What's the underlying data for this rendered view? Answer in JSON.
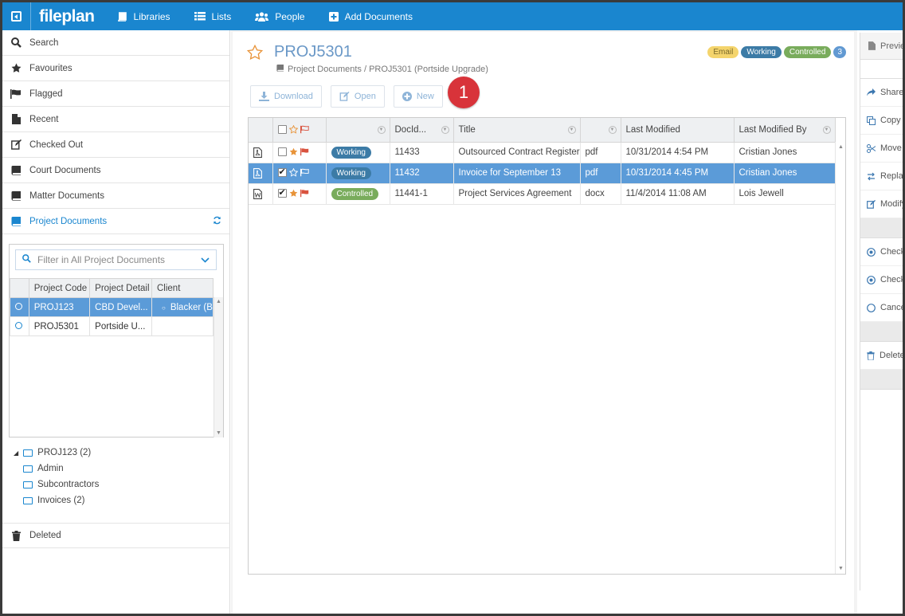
{
  "app": {
    "logo": "fileplan"
  },
  "nav": [
    {
      "label": "Libraries",
      "icon": "book-icon"
    },
    {
      "label": "Lists",
      "icon": "list-icon"
    },
    {
      "label": "People",
      "icon": "people-icon"
    },
    {
      "label": "Add Documents",
      "icon": "plus-box-icon"
    }
  ],
  "sidebar": {
    "items": [
      {
        "label": "Search"
      },
      {
        "label": "Favourites"
      },
      {
        "label": "Flagged"
      },
      {
        "label": "Recent"
      },
      {
        "label": "Checked Out"
      },
      {
        "label": "Court Documents"
      },
      {
        "label": "Matter Documents"
      },
      {
        "label": "Project Documents"
      }
    ],
    "filter_placeholder": "Filter in All Project Documents",
    "table": {
      "headers": [
        "Project Code",
        "Project Detail",
        "Client"
      ],
      "rows": [
        {
          "code": "PROJ123",
          "detail": "CBD Devel...",
          "client": "Blacker (B"
        },
        {
          "code": "PROJ5301",
          "detail": "Portside U...",
          "client": ""
        }
      ]
    },
    "tree": {
      "root": "PROJ123 (2)",
      "children": [
        "Admin",
        "Subcontractors",
        "Invoices (2)"
      ]
    },
    "deleted_label": "Deleted"
  },
  "main": {
    "title": "PROJ5301",
    "breadcrumb": "Project Documents / PROJ5301 (Portside Upgrade)",
    "badges": {
      "email": "Email",
      "working": "Working",
      "controlled": "Controlled",
      "count": "3"
    },
    "toolbar": {
      "download": "Download",
      "open": "Open",
      "new": "New"
    },
    "step_marker": "1",
    "grid": {
      "headers": {
        "docid": "DocId...",
        "title": "Title",
        "last_modified": "Last Modified",
        "last_modified_by": "Last Modified By"
      },
      "rows": [
        {
          "file": "pdf-icon",
          "checked": false,
          "fav": true,
          "flag": true,
          "status": "Working",
          "docid": "11433",
          "title": "Outsourced Contract Register",
          "type": "pdf",
          "modified": "10/31/2014 4:54 PM",
          "by": "Cristian Jones"
        },
        {
          "file": "pdf-icon",
          "checked": true,
          "fav": false,
          "flag": false,
          "status": "Working",
          "docid": "11432",
          "title": "Invoice for September 13",
          "type": "pdf",
          "modified": "10/31/2014 4:45 PM",
          "by": "Cristian Jones"
        },
        {
          "file": "word-icon",
          "checked": true,
          "fav": true,
          "flag": true,
          "status": "Controlled",
          "docid": "11441-1",
          "title": "Project Services Agreement",
          "type": "docx",
          "modified": "11/4/2014 11:08 AM",
          "by": "Lois Jewell"
        }
      ]
    }
  },
  "right_panel": {
    "preview": "Previe",
    "items": [
      "Share",
      "Copy D",
      "Move",
      "Replac",
      "Modify"
    ],
    "checks": [
      "Check",
      "Checki",
      "Cancel"
    ],
    "delete": "Delete"
  }
}
